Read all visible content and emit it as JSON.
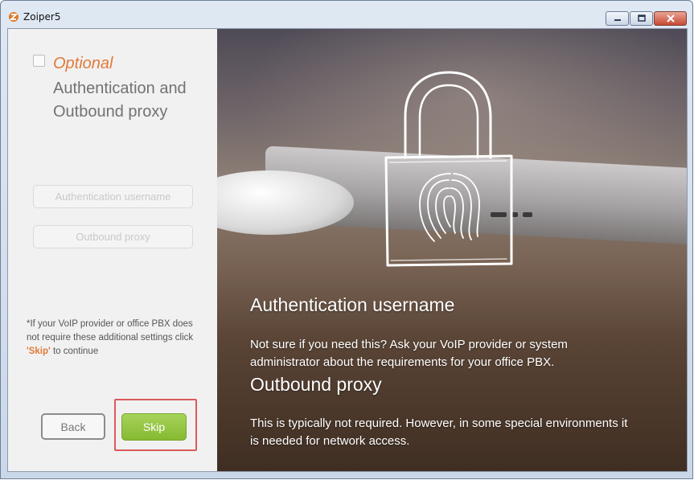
{
  "window": {
    "title": "Zoiper5",
    "controls": {
      "minimize_icon": "minimize-icon",
      "maximize_icon": "maximize-icon",
      "close_icon": "close-icon"
    }
  },
  "left_panel": {
    "step_label": "Optional",
    "step_title": "Authentication and Outbound proxy",
    "fields": {
      "auth_username": {
        "placeholder": "Authentication username",
        "value": ""
      },
      "outbound_proxy": {
        "placeholder": "Outbound proxy",
        "value": ""
      }
    },
    "hint": {
      "before": "*If your VoIP provider or office PBX does not require these additional settings click ",
      "highlight": "'Skip'",
      "after": " to continue"
    },
    "buttons": {
      "back": "Back",
      "skip": "Skip"
    }
  },
  "right_panel": {
    "sections": [
      {
        "heading": "Authentication username",
        "text": "Not sure if you need this? Ask your VoIP provider or system administrator about the requirements for your office PBX."
      },
      {
        "heading": "Outbound proxy",
        "text": "This is typically not required. However, in some special environments it is needed for network access."
      }
    ]
  },
  "colors": {
    "accent_orange": "#e07b39",
    "skip_green": "#8cbf3a",
    "highlight_red": "#dc5a5a",
    "field_text": "#c9c9c9"
  }
}
